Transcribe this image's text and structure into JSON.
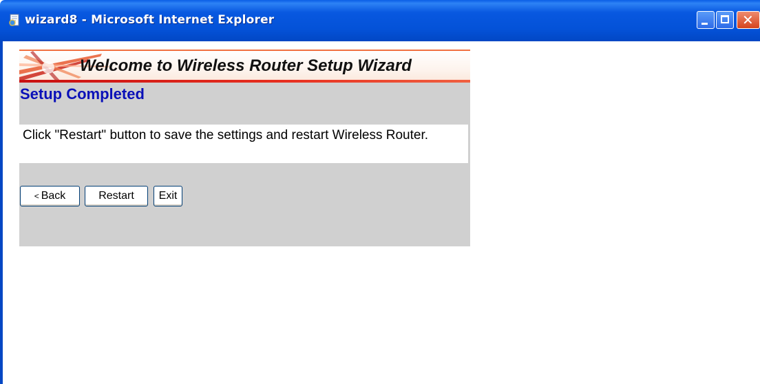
{
  "window": {
    "title": "wizard8 - Microsoft Internet Explorer",
    "icon": "ie-page-icon",
    "controls": [
      "minimize",
      "maximize",
      "close"
    ],
    "close_glyph": "✕"
  },
  "wizard": {
    "banner_title": "Welcome to Wireless Router Setup Wizard",
    "heading": "Setup Completed",
    "message": "Click \"Restart\" button to save the settings and restart Wireless Router.",
    "buttons": {
      "back_glyph": "<",
      "back": "Back",
      "restart": "Restart",
      "exit": "Exit"
    }
  },
  "colors": {
    "titlebar": "#0452d8",
    "heading": "#0a10b8",
    "panel": "#d0d0d0",
    "banner_accent": "#e83020"
  }
}
